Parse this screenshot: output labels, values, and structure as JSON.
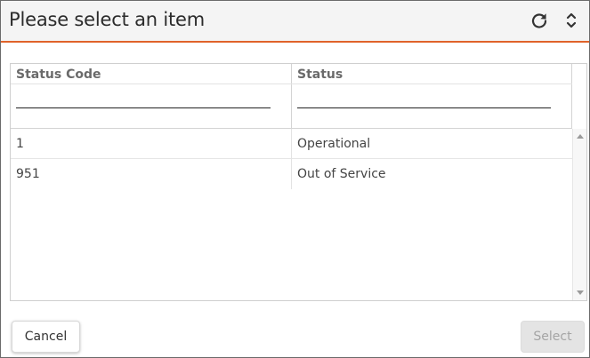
{
  "dialog": {
    "title": "Please select an item"
  },
  "toolbar": {
    "refresh_icon": "refresh-icon",
    "collapse_icon": "expand-collapse-icon"
  },
  "table": {
    "columns": [
      "Status Code",
      "Status"
    ],
    "filters": [
      "",
      ""
    ],
    "rows": [
      [
        "1",
        "Operational"
      ],
      [
        "951",
        "Out of Service"
      ]
    ]
  },
  "footer": {
    "cancel_label": "Cancel",
    "select_label": "Select"
  },
  "colors": {
    "accent": "#e0632a",
    "disabled_button": "#e4e4e4"
  }
}
